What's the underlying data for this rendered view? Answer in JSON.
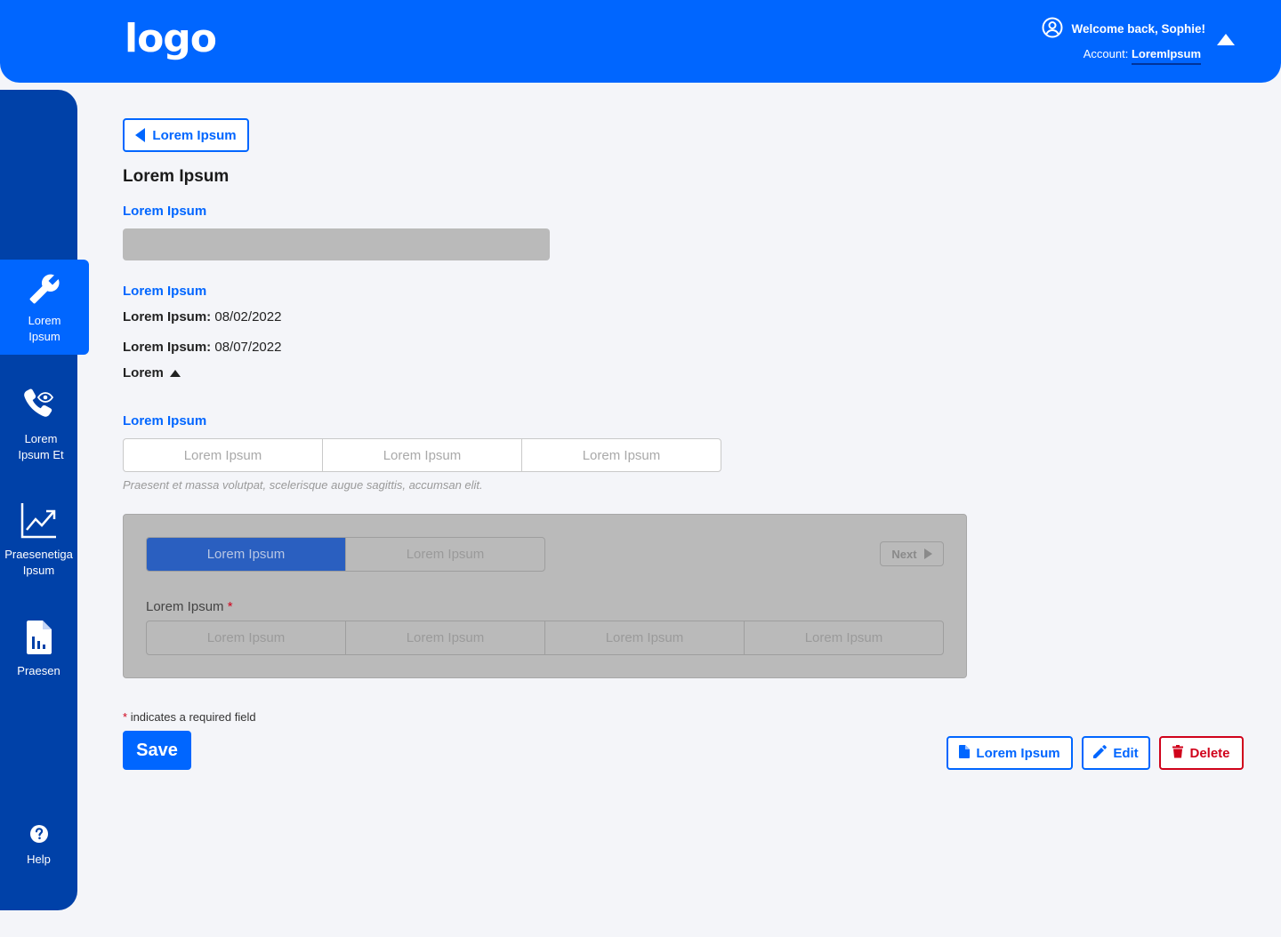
{
  "header": {
    "logo": "logo",
    "welcome": "Welcome back, Sophie!",
    "account_label": "Account:",
    "account_name": "LoremIpsum"
  },
  "sidebar": {
    "items": [
      {
        "line1": "Lorem",
        "line2": "Ipsum",
        "icon": "wrench-icon",
        "active": true
      },
      {
        "line1": "Lorem",
        "line2": "Ipsum Et",
        "icon": "phone-eye-icon"
      },
      {
        "line1": "Praesenetiga",
        "line2": "Ipsum",
        "icon": "trend-chart-icon"
      },
      {
        "line1": "Praesen",
        "line2": "",
        "icon": "report-file-icon"
      },
      {
        "line1": "Help",
        "line2": "",
        "icon": "help-icon"
      }
    ]
  },
  "main": {
    "back_label": "Lorem Ipsum",
    "title": "Lorem Ipsum",
    "section1_label": "Lorem Ipsum",
    "section2_label": "Lorem Ipsum",
    "date1_label": "Lorem Ipsum:",
    "date1_value": "08/02/2022",
    "date2_label": "Lorem Ipsum:",
    "date2_value": "08/07/2022",
    "toggle_label": "Lorem",
    "section3_label": "Lorem Ipsum",
    "segment_options": [
      "Lorem Ipsum",
      "Lorem Ipsum",
      "Lorem Ipsum"
    ],
    "helper_text": "Praesent et massa volutpat, scelerisque augue sagittis, accumsan elit."
  },
  "panel": {
    "tabs": [
      "Lorem Ipsum",
      "Lorem Ipsum"
    ],
    "selected_tab": 0,
    "next_label": "Next",
    "field_label": "Lorem Ipsum",
    "required_mark": "*",
    "options": [
      "Lorem Ipsum",
      "Lorem Ipsum",
      "Lorem Ipsum",
      "Lorem Ipsum"
    ]
  },
  "footer": {
    "required_mark": "*",
    "required_note": "indicates a required field",
    "save_label": "Save",
    "doc_label": "Lorem Ipsum",
    "edit_label": "Edit",
    "delete_label": "Delete"
  },
  "colors": {
    "primary": "#0066ff",
    "sidebar": "#0041a8",
    "danger": "#d0021b",
    "background": "#f4f5f9"
  }
}
